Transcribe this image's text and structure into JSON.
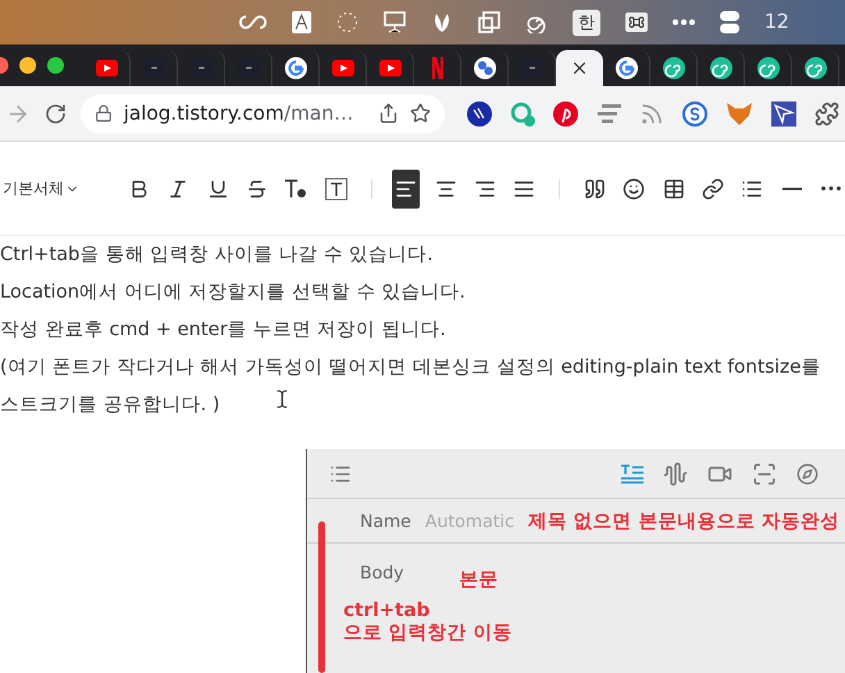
{
  "menu_bar": {
    "input_source": "한",
    "clock": "12"
  },
  "tabs": [
    {
      "kind": "youtube",
      "selected": false
    },
    {
      "kind": "dark",
      "selected": false
    },
    {
      "kind": "dark",
      "selected": false
    },
    {
      "kind": "dark",
      "selected": false
    },
    {
      "kind": "google",
      "selected": false
    },
    {
      "kind": "youtube",
      "selected": false
    },
    {
      "kind": "youtube",
      "selected": false
    },
    {
      "kind": "netflix",
      "selected": false
    },
    {
      "kind": "circles",
      "selected": false
    },
    {
      "kind": "dark",
      "selected": false
    },
    {
      "kind": "current",
      "selected": true
    },
    {
      "kind": "google",
      "selected": false
    },
    {
      "kind": "swirl",
      "selected": false
    },
    {
      "kind": "swirl",
      "selected": false
    },
    {
      "kind": "swirl",
      "selected": false
    },
    {
      "kind": "swirl",
      "selected": false
    }
  ],
  "address_bar": {
    "host": "jalog.tistory.com",
    "path": "/man…"
  },
  "extensions": [
    {
      "kind": "steem"
    },
    {
      "kind": "chat"
    },
    {
      "kind": "pinterest"
    },
    {
      "kind": "lines"
    },
    {
      "kind": "rss"
    },
    {
      "kind": "s-circle"
    },
    {
      "kind": "fox"
    },
    {
      "kind": "arrow"
    },
    {
      "kind": "puzzle"
    }
  ],
  "editor_toolbar": {
    "font": "기본서체",
    "format_tools": [
      {
        "kind": "bold"
      },
      {
        "kind": "italic"
      },
      {
        "kind": "underline"
      },
      {
        "kind": "strike"
      },
      {
        "kind": "color"
      },
      {
        "kind": "bg"
      }
    ],
    "align_tools": [
      {
        "kind": "align-left",
        "selected": true
      },
      {
        "kind": "align-center",
        "selected": false
      },
      {
        "kind": "align-right",
        "selected": false
      },
      {
        "kind": "justify",
        "selected": false
      }
    ],
    "insert_tools": [
      {
        "kind": "quote"
      },
      {
        "kind": "emoji"
      },
      {
        "kind": "table"
      },
      {
        "kind": "link"
      },
      {
        "kind": "list"
      },
      {
        "kind": "rule"
      },
      {
        "kind": "more"
      }
    ]
  },
  "paragraphs": [
    "Ctrl+tab을 통해 입력창 사이를 나갈 수 있습니다.",
    "Location에서 어디에 저장할지를 선택할 수 있습니다.",
    "작성 완료후  cmd + enter를 누르면 저장이 됩니다.",
    "(여기 폰트가 작다거나 해서 가독성이 떨어지면 데본싱크 설정의 editing-plain text fontsize를",
    "스트크기를 공유합니다. )"
  ],
  "embedded_app": {
    "tools": [
      {
        "kind": "text",
        "selected": true
      },
      {
        "kind": "audio",
        "selected": false
      },
      {
        "kind": "video",
        "selected": false
      },
      {
        "kind": "scan",
        "selected": false
      },
      {
        "kind": "compass",
        "selected": false
      }
    ],
    "name_label": "Name",
    "name_placeholder": "Automatic",
    "name_note": "제목 없으면 본문내용으로 자동완성",
    "body_label": "Body",
    "body_note": "본문",
    "tab_note": [
      "ctrl+tab",
      "으로 입력창간 이동"
    ]
  }
}
